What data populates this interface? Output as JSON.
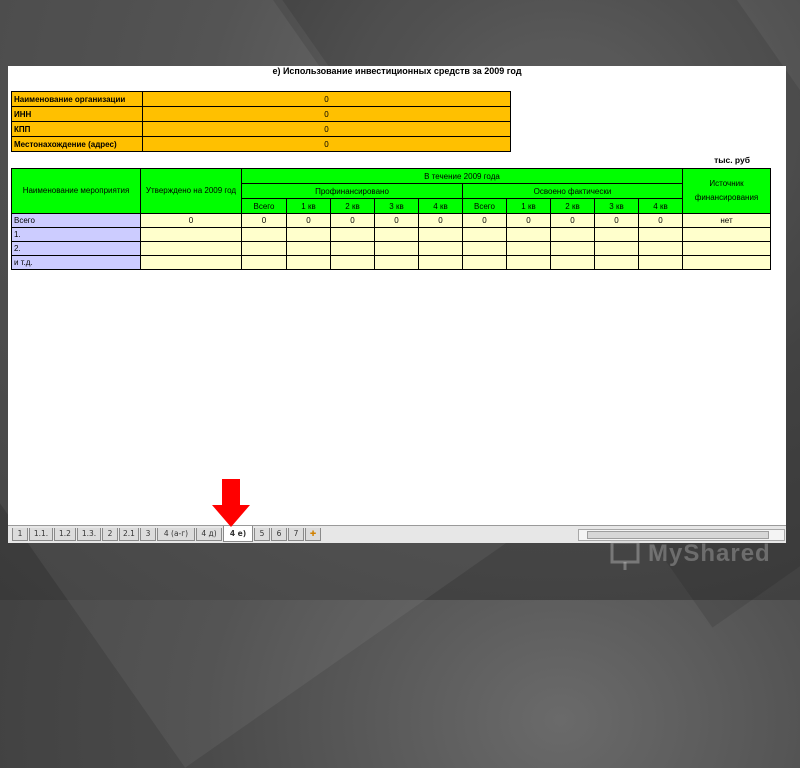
{
  "title": "е) Использование инвестиционных средств за 2009 год",
  "org_info": [
    {
      "label": "Наименование организации",
      "value": "0"
    },
    {
      "label": "ИНН",
      "value": "0"
    },
    {
      "label": "КПП",
      "value": "0"
    },
    {
      "label": "Местонахождение (адрес)",
      "value": "0"
    }
  ],
  "unit": "тыс. руб",
  "table": {
    "h_name": "Наименование мероприятия",
    "h_approved": "Утверждено на 2009 год",
    "h_during": "В течение 2009 года",
    "h_financed": "Профинансировано",
    "h_mastered": "Освоено фактически",
    "h_source": "Источник финансирования",
    "subcols": [
      "Всего",
      "1 кв",
      "2 кв",
      "3 кв",
      "4 кв",
      "Всего",
      "1 кв",
      "2 кв",
      "3 кв",
      "4 кв"
    ],
    "rows": [
      {
        "name": "Всего",
        "approved": "0",
        "vals": [
          "0",
          "0",
          "0",
          "0",
          "0",
          "0",
          "0",
          "0",
          "0",
          "0"
        ],
        "source": "нет"
      },
      {
        "name": "1.",
        "approved": "",
        "vals": [
          "",
          "",
          "",
          "",
          "",
          "",
          "",
          "",
          "",
          ""
        ],
        "source": ""
      },
      {
        "name": "2.",
        "approved": "",
        "vals": [
          "",
          "",
          "",
          "",
          "",
          "",
          "",
          "",
          "",
          ""
        ],
        "source": ""
      },
      {
        "name": "и т.д.",
        "approved": "",
        "vals": [
          "",
          "",
          "",
          "",
          "",
          "",
          "",
          "",
          "",
          ""
        ],
        "source": ""
      }
    ]
  },
  "sheet_tabs": [
    "1",
    "1.1.",
    "1.2",
    "1.3.",
    "2",
    "2.1",
    "3",
    "4 (а-г)",
    "4 д)",
    "4 е)",
    "5",
    "6",
    "7"
  ],
  "active_tab": "4 е)",
  "colors": {
    "org_bg": "#ffc000",
    "header_bg": "#00ff00",
    "name_bg": "#ccccff",
    "cell_bg": "#ffffcc",
    "arrow": "#ff0000"
  },
  "watermark": "MyShared"
}
